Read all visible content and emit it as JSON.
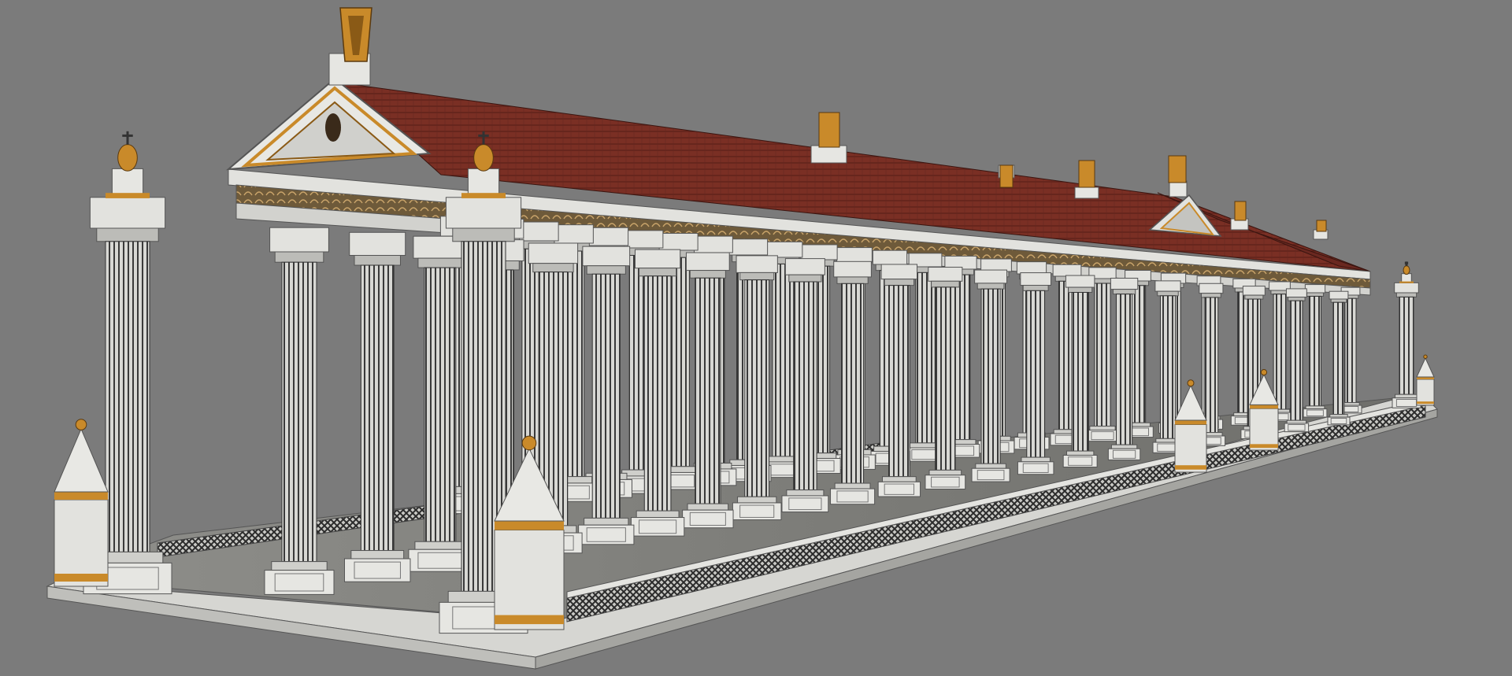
{
  "viewport": {
    "background": "#7b7b7b"
  },
  "palette": {
    "marble_light": "#e4e4e0",
    "marble_mid": "#c6c6c2",
    "marble_shadow": "#9a9a96",
    "column_dark": "#3c3c3c",
    "column_flute": "#d8d8d4",
    "roof_tile": "#7a2f24",
    "roof_tile_dark": "#5a1f18",
    "gold_trim": "#c98a2a",
    "gold_dark": "#8a5a16",
    "floor": "#8c8c88",
    "lattice": "#2a2a2a"
  },
  "scene": {
    "subject": "3d-colonnade-model",
    "wireframe": true
  }
}
